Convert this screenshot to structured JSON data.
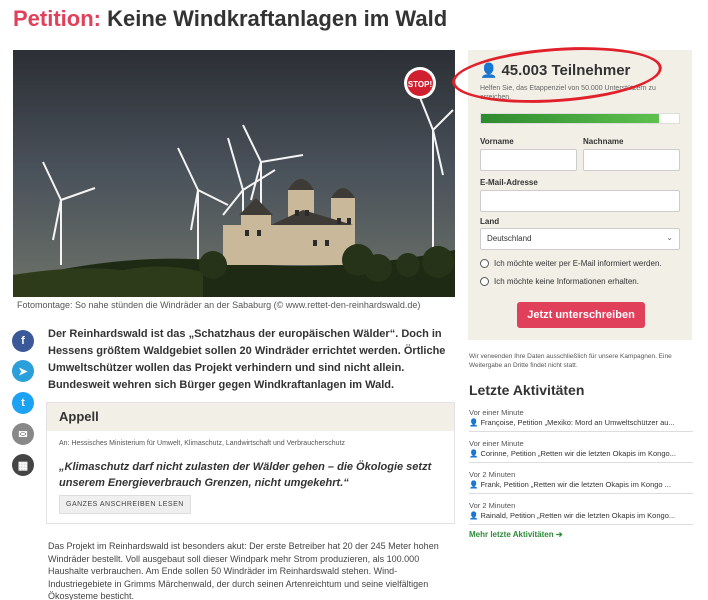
{
  "header": {
    "title_accent": "Petition:",
    "title_main": "Keine Windkraftanlagen im Wald"
  },
  "hero": {
    "caption": "Fotomontage: So nahe stünden die Windräder an der Sababurg (© www.rettet-den-reinhardswald.de)",
    "badge": "STOP!"
  },
  "share": {
    "facebook": "f",
    "telegram": "➤",
    "twitter": "t",
    "email": "✉",
    "qr": "▦"
  },
  "intro": "Der Reinhardswald ist das „Schatzhaus der europäischen Wälder“. Doch in Hessens größtem Waldgebiet sollen 20 Windräder errichtet werden. Örtliche Umweltschützer wollen das Projekt verhindern und sind nicht allein. Bundesweit wehren sich Bürger gegen Windkraftanlagen im Wald.",
  "appeal": {
    "heading": "Appell",
    "to": "An: Hessisches Ministerium für Umwelt, Klimaschutz, Landwirtschaft und Verbraucherschutz",
    "quote": "„Klimaschutz darf nicht zulasten der Wälder gehen – die Ökologie setzt unserem Energieverbrauch Grenzen, nicht umgekehrt.“",
    "button": "GANZES ANSCHREIBEN LESEN"
  },
  "body_text": "Das Projekt im Reinhardswald ist besonders akut: Der erste Betreiber hat 20 der 245 Meter hohen Windräder bestellt. Voll ausgebaut soll dieser Windpark mehr Strom produzieren, als 100.000 Haushalte verbrauchen. Am Ende sollen 50 Windräder im Reinhardswald stehen. Wind-Industriegebiete in Grimms Märchenwald, der durch seinen Artenreichtum und seine vielfältigen Ökosysteme besticht.",
  "form": {
    "count": "45.003 Teilnehmer",
    "count_sub": "Helfen Sie, das Etappenziel von 50.000 Unterstützern zu erreichen.",
    "progress": 0.9,
    "firstname_label": "Vorname",
    "lastname_label": "Nachname",
    "email_label": "E-Mail-Adresse",
    "country_label": "Land",
    "country_value": "Deutschland",
    "radio_yes": "Ich möchte weiter per E-Mail informiert werden.",
    "radio_no": "Ich möchte keine Informationen erhalten.",
    "submit": "Jetzt unterschreiben"
  },
  "privacy": "Wir verwenden Ihre Daten ausschließlich für unsere Kampagnen. Eine Weitergabe an Dritte findet nicht statt.",
  "activities": {
    "title": "Letzte Aktivitäten",
    "items": [
      {
        "time": "Vor einer Minute",
        "who": "Françoise, Petition „Mexiko: Mord an Umweltschützer au..."
      },
      {
        "time": "Vor einer Minute",
        "who": "Corinne, Petition „Retten wir die letzten Okapis im Kongo..."
      },
      {
        "time": "Vor 2 Minuten",
        "who": "Frank, Petition „Retten wir die letzten Okapis im Kongo ..."
      },
      {
        "time": "Vor 2 Minuten",
        "who": "Rainald, Petition „Retten wir die letzten Okapis im Kongo..."
      }
    ],
    "more": "Mehr letzte Aktivitäten ➔"
  },
  "colors": {
    "accent": "#e0405a",
    "panel": "#f2efe7",
    "progress": "#3fa03a",
    "highlight": "#e0202a"
  }
}
